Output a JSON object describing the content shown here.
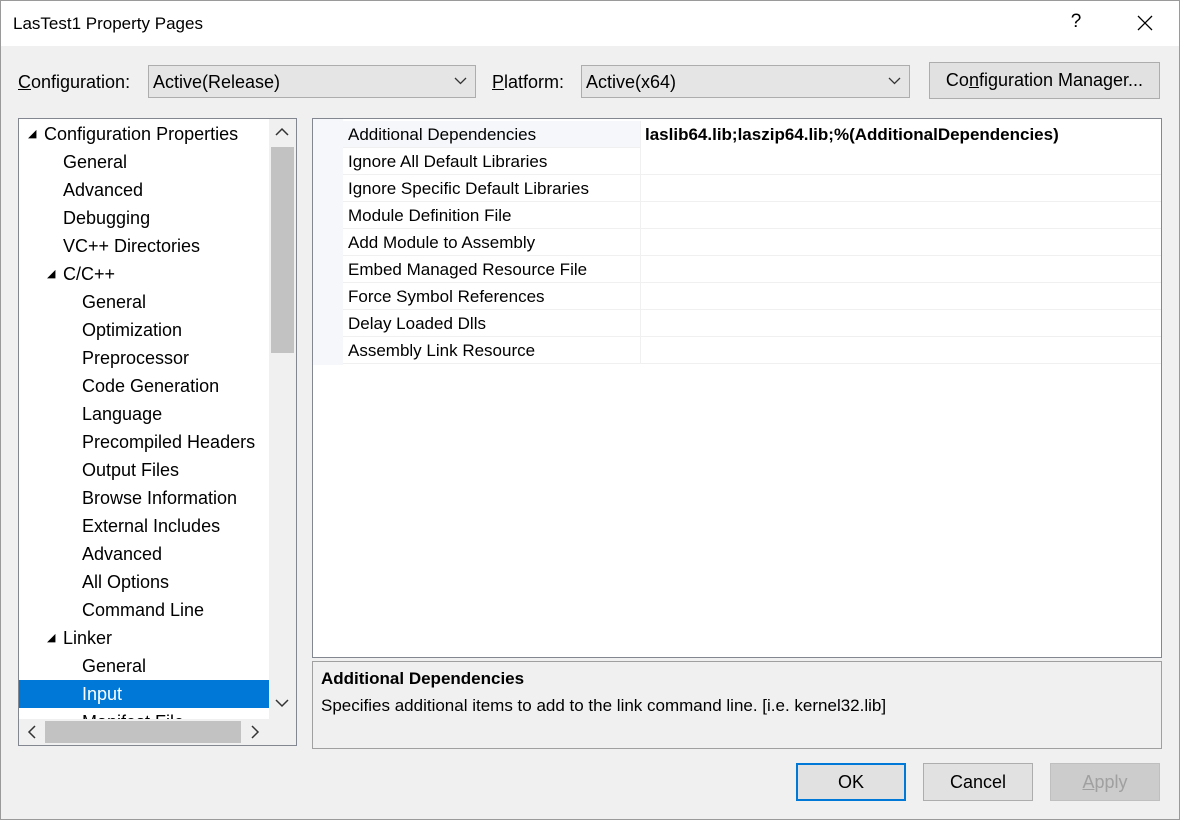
{
  "window": {
    "title": "LasTest1 Property Pages",
    "help_glyph": "?"
  },
  "header": {
    "configuration_label_accel": "C",
    "configuration_label_rest": "onfiguration:",
    "configuration_value": "Active(Release)",
    "platform_label_accel": "P",
    "platform_label_rest": "latform:",
    "platform_value": "Active(x64)",
    "config_manager_pre": "Co",
    "config_manager_accel": "n",
    "config_manager_post": "figuration Manager..."
  },
  "tree": {
    "items": [
      {
        "label": "Configuration Properties",
        "expander": "◢"
      },
      {
        "label": "General"
      },
      {
        "label": "Advanced"
      },
      {
        "label": "Debugging"
      },
      {
        "label": "VC++ Directories"
      },
      {
        "label": "C/C++",
        "expander": "◢"
      },
      {
        "label": "General"
      },
      {
        "label": "Optimization"
      },
      {
        "label": "Preprocessor"
      },
      {
        "label": "Code Generation"
      },
      {
        "label": "Language"
      },
      {
        "label": "Precompiled Headers"
      },
      {
        "label": "Output Files"
      },
      {
        "label": "Browse Information"
      },
      {
        "label": "External Includes"
      },
      {
        "label": "Advanced"
      },
      {
        "label": "All Options"
      },
      {
        "label": "Command Line"
      },
      {
        "label": "Linker",
        "expander": "◢"
      },
      {
        "label": "General"
      },
      {
        "label": "Input",
        "selected": true
      },
      {
        "label": "Manifest File"
      }
    ]
  },
  "grid": {
    "rows": [
      {
        "name": "Additional Dependencies",
        "value": "laslib64.lib;laszip64.lib;%(AdditionalDependencies)"
      },
      {
        "name": "Ignore All Default Libraries",
        "value": ""
      },
      {
        "name": "Ignore Specific Default Libraries",
        "value": ""
      },
      {
        "name": "Module Definition File",
        "value": ""
      },
      {
        "name": "Add Module to Assembly",
        "value": ""
      },
      {
        "name": "Embed Managed Resource File",
        "value": ""
      },
      {
        "name": "Force Symbol References",
        "value": ""
      },
      {
        "name": "Delay Loaded Dlls",
        "value": ""
      },
      {
        "name": "Assembly Link Resource",
        "value": ""
      }
    ]
  },
  "description": {
    "title": "Additional Dependencies",
    "text": "Specifies additional items to add to the link command line. [i.e. kernel32.lib]"
  },
  "footer": {
    "ok": "OK",
    "cancel": "Cancel",
    "apply_accel": "A",
    "apply_rest": "pply"
  },
  "colors": {
    "accent": "#0078d7",
    "dialog_bg": "#f0f0f0"
  }
}
